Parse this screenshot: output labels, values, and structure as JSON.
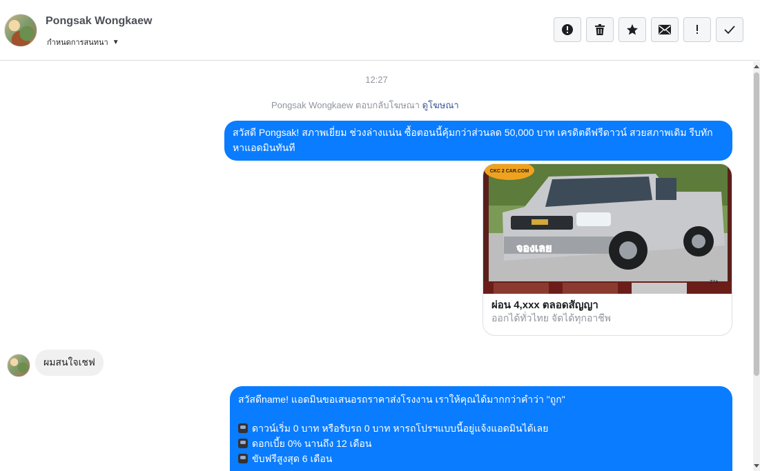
{
  "header": {
    "contact_name": "Pongsak Wongkaew",
    "manage_label": "กำหนดการสนทนา",
    "actions": [
      {
        "name": "report-button",
        "icon": "alert-circle-icon"
      },
      {
        "name": "delete-button",
        "icon": "trash-icon"
      },
      {
        "name": "star-button",
        "icon": "star-icon"
      },
      {
        "name": "mark-unread-button",
        "icon": "envelope-icon"
      },
      {
        "name": "spam-button",
        "icon": "exclamation-icon"
      },
      {
        "name": "mark-done-button",
        "icon": "checkmark-icon"
      }
    ]
  },
  "conversation": {
    "timestamp": "12:27",
    "ad_reply_prefix": "Pongsak Wongkaew ตอบกลับโฆษณา",
    "ad_reply_link": "ดูโฆษณา",
    "outgoing_1": "สวัสดี Pongsak!  สภาพเยี่ยม ช่วงล่างแน่น  ซื้อตอนนี้คุ้มกว่าส่วนลด 50,000 บาท เครดิตดีฟรีดาวน์  สวยสภาพเดิม รีบทักหาแอดมินทันที",
    "card": {
      "badge_text": "CKC 2 CAR.COM",
      "overlay_text": "จองเลย",
      "corner_code": "Z74",
      "title": "ผ่อน 4,xxx ตลอดสัญญา",
      "subtitle": "ออกได้ทั่วไทย จัดได้ทุกอาชีพ"
    },
    "incoming_1": "ผมสนใจเชฟ",
    "outgoing_2": {
      "intro": "สวัสดีname! แอดมินขอเสนอรถราคาส่งโรงงาน เราให้คุณได้มากกว่าคำว่า \"ถูก\"",
      "lines": [
        "ดาวน์เริ่ม 0 บาท หรือรับรถ 0 บาท หารถโปรฯแบบนี้อยู่แจ้งแอดมินได้เลย",
        "ดอกเบี้ย 0% นานถึง 12 เดือน",
        "ขับฟรีสูงสุด 6 เดือน"
      ]
    }
  },
  "colors": {
    "outgoing_bubble": "#0a7cff",
    "incoming_bubble": "#f1f0f0",
    "link": "#385898"
  }
}
